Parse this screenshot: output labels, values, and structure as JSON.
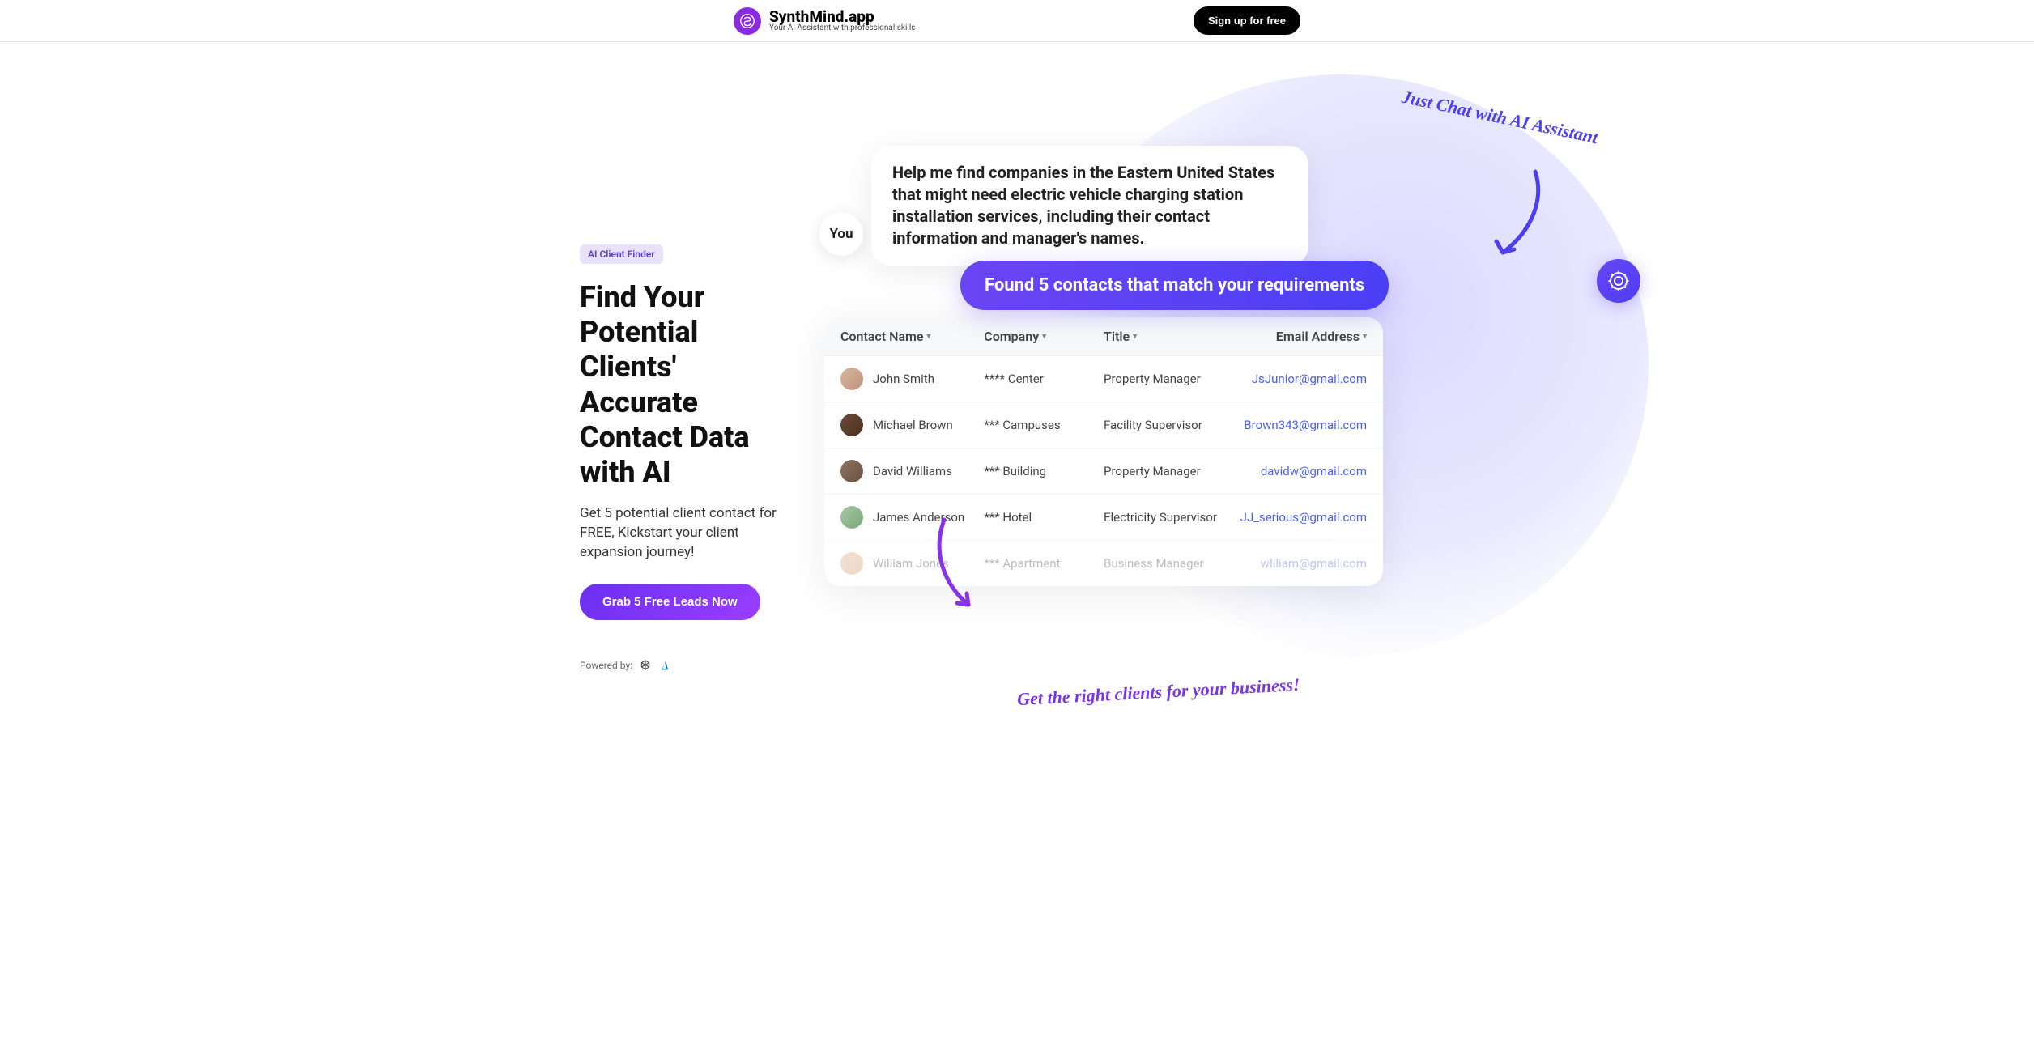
{
  "header": {
    "brand_name": "SynthMind.app",
    "brand_tagline": "Your AI Assistant with professional skills",
    "signup_label": "Sign up for free"
  },
  "hero": {
    "badge": "AI Client Finder",
    "headline": "Find Your Potential Clients' Accurate Contact Data with AI",
    "subhead": "Get 5 potential client contact for FREE, Kickstart your client expansion journey!",
    "cta_label": "Grab 5 Free Leads Now",
    "powered_label": "Powered by:"
  },
  "annotations": {
    "top": "Just Chat with AI Assistant",
    "bottom": "Get the right clients for your business!"
  },
  "chat": {
    "you_label": "You",
    "user_message": "Help me find companies in the Eastern United States that might need electric vehicle charging station installation services, including their contact information and manager's names.",
    "ai_response": "Found 5 contacts that match your requirements"
  },
  "contacts": {
    "columns": {
      "name": "Contact Name",
      "company": "Company",
      "title": "Title",
      "email": "Email Address"
    },
    "rows": [
      {
        "name": "John Smith",
        "company": "**** Center",
        "title": "Property Manager",
        "email": "JsJunior@gmail.com"
      },
      {
        "name": "Michael Brown",
        "company": "*** Campuses",
        "title": "Facility Supervisor",
        "email": "Brown343@gmail.com"
      },
      {
        "name": "David Williams",
        "company": "*** Building",
        "title": "Property Manager",
        "email": "davidw@gmail.com"
      },
      {
        "name": "James Anderson",
        "company": "*** Hotel",
        "title": "Electricity Supervisor",
        "email": "JJ_serious@gmail.com"
      },
      {
        "name": "William Jones",
        "company": "*** Apartment",
        "title": "Business Manager",
        "email": "wllliam@gmail.com"
      }
    ]
  }
}
